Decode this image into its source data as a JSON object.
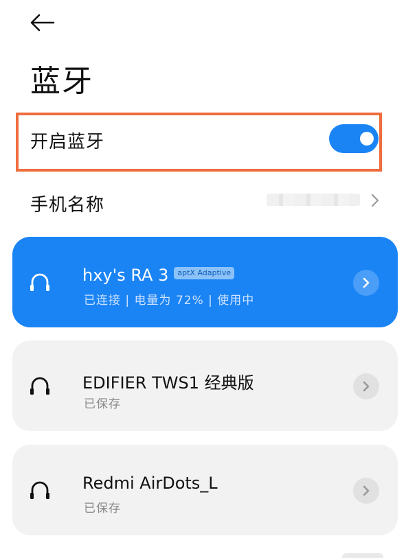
{
  "header": {
    "back_icon": "back-arrow-icon",
    "title": "蓝牙"
  },
  "bluetooth_toggle": {
    "label": "开启蓝牙",
    "enabled": true,
    "accent_color": "#1a84f5",
    "highlight_color": "#ee6d3d"
  },
  "phone_name": {
    "label": "手机名称",
    "value": ""
  },
  "devices": [
    {
      "name": "hxy's RA 3",
      "codec": "aptX Adaptive",
      "status": "已连接 | 电量为 72% | 使用中",
      "connected": true,
      "icon": "headphones-icon"
    },
    {
      "name": "EDIFIER TWS1 经典版",
      "status": "已保存",
      "connected": false,
      "icon": "headphones-icon"
    },
    {
      "name": "Redmi AirDots_L",
      "status": "已保存",
      "connected": false,
      "icon": "headphones-icon"
    }
  ]
}
